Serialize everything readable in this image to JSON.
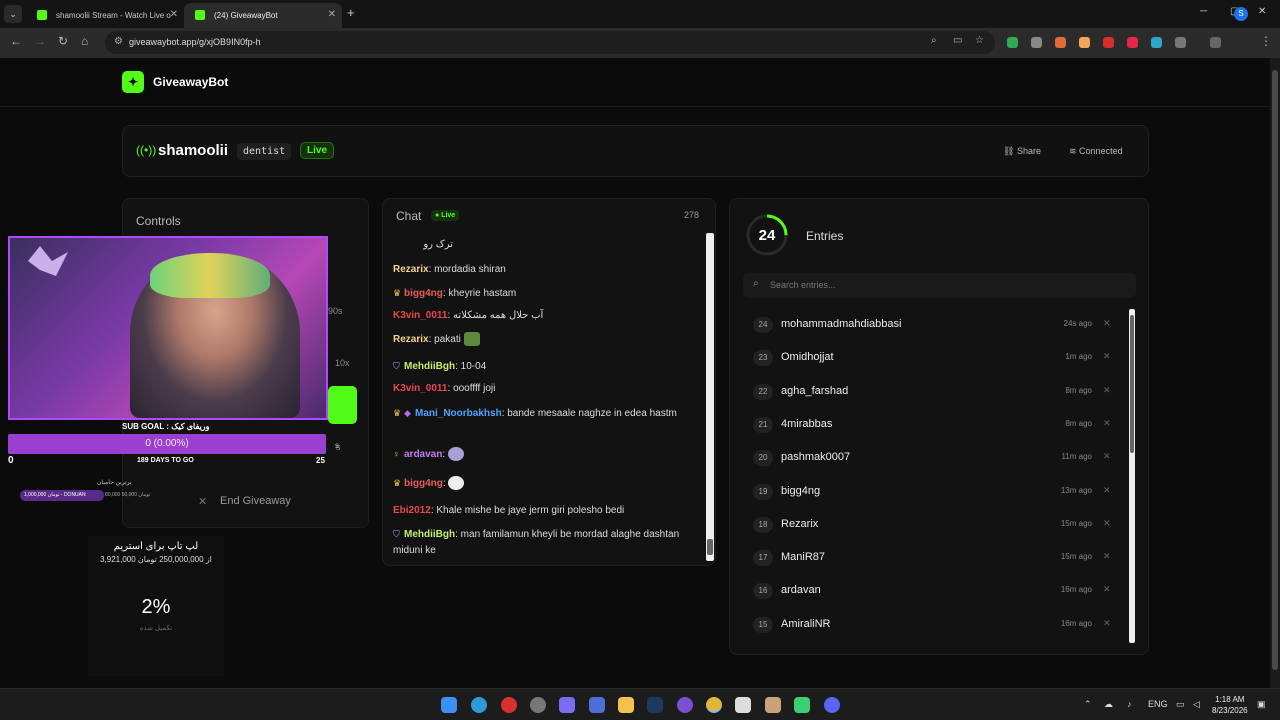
{
  "browser": {
    "tabs": [
      {
        "title": "shamoolii Stream - Watch Live o",
        "favicon_color": "#53fc18"
      },
      {
        "title": "(24) GiveawayBot",
        "favicon_color": "#53fc18"
      }
    ],
    "url": "giveawaybot.app/g/xjOB9IN0fp-h",
    "profile_initial": "S"
  },
  "app": {
    "logo_glyph": "✦",
    "name": "GiveawayBot"
  },
  "channel": {
    "name": "shamoolii",
    "category": "dentist",
    "live_label": "Live",
    "share_label": "Share",
    "connected_label": "Connected"
  },
  "controls": {
    "title": "Controls",
    "seconds_label": "90s",
    "multiplier": "10x",
    "end_label": "End Giveaway",
    "s_label": "s"
  },
  "overlay": {
    "sub_goal": "SUB GOAL : وریفای کیک",
    "goal_progress": "0 (0.00%)",
    "goal_min": "0",
    "goal_max": "25",
    "days_to_go": "189 DAYS TO GO",
    "top_donors_label": "برترین حامیان",
    "top_donor": "1,000,000 تومان - DONUAN",
    "donor_more": "80,000 تومان  50,000",
    "donate_title": "لپ تاپ برای استریم",
    "donate_amount": "3,921,000 از 250,000,000 تومان",
    "donate_percent": "2%",
    "donate_done": "تکمیل شده"
  },
  "chat": {
    "title": "Chat",
    "live_label": "Live",
    "count": "278",
    "messages": [
      {
        "user": "",
        "text": "ترک رو",
        "color": "#dddddd"
      },
      {
        "user": "Rezarix",
        "text": "mordadia shiran",
        "color": "#f5d38a",
        "badge": ""
      },
      {
        "user": "bigg4ng",
        "text": "kheyrie hastam",
        "color": "#e85d5d",
        "badge": "crown"
      },
      {
        "user": "K3vin_0011",
        "text": "آب حلال همه مشکلاته",
        "color": "#e8484e",
        "badge": ""
      },
      {
        "user": "Rezarix",
        "text": "pakati",
        "color": "#f5d38a",
        "badge": ""
      },
      {
        "user": "MehdiiBgh",
        "text": "10-04",
        "color": "#c2f06a",
        "badge": "shield"
      },
      {
        "user": "K3vin_0011",
        "text": "oooffff joji",
        "color": "#e8484e",
        "badge": ""
      },
      {
        "user": "Mani_Noorbakhsh",
        "text": "bande mesaale naghze in edea hastm",
        "color": "#4aa3ff",
        "badge": "crown-gem"
      },
      {
        "user": "ardavan",
        "text": "",
        "color": "#c37cf5",
        "badge": "pin"
      },
      {
        "user": "bigg4ng",
        "text": "",
        "color": "#e85d5d",
        "badge": "crown"
      },
      {
        "user": "Ebi2012",
        "text": "Khale mishe be jaye jerm giri polesho bedi",
        "color": "#e8484e",
        "badge": ""
      },
      {
        "user": "MehdiiBgh",
        "text": "man familamun kheyli be mordad alaghe dashtan miduni ke",
        "color": "#c2f06a",
        "badge": "shield"
      }
    ]
  },
  "entries": {
    "title": "Entries",
    "count": "24",
    "search_placeholder": "Search entries...",
    "rows": [
      {
        "n": "24",
        "name": "mohammadmahdiabbasi",
        "time": "24s ago"
      },
      {
        "n": "23",
        "name": "Omidhojjat",
        "time": "1m ago"
      },
      {
        "n": "22",
        "name": "agha_farshad",
        "time": "8m ago"
      },
      {
        "n": "21",
        "name": "4mirabbas",
        "time": "8m ago"
      },
      {
        "n": "20",
        "name": "pashmak0007",
        "time": "11m ago"
      },
      {
        "n": "19",
        "name": "bigg4ng",
        "time": "13m ago"
      },
      {
        "n": "18",
        "name": "Rezarix",
        "time": "15m ago"
      },
      {
        "n": "17",
        "name": "ManiR87",
        "time": "15m ago"
      },
      {
        "n": "16",
        "name": "ardavan",
        "time": "16m ago"
      },
      {
        "n": "15",
        "name": "AmiraliNR",
        "time": "16m ago"
      }
    ]
  },
  "taskbar": {
    "lang": "ENG",
    "time": "1:18 AM",
    "date": "8/23/2026"
  }
}
